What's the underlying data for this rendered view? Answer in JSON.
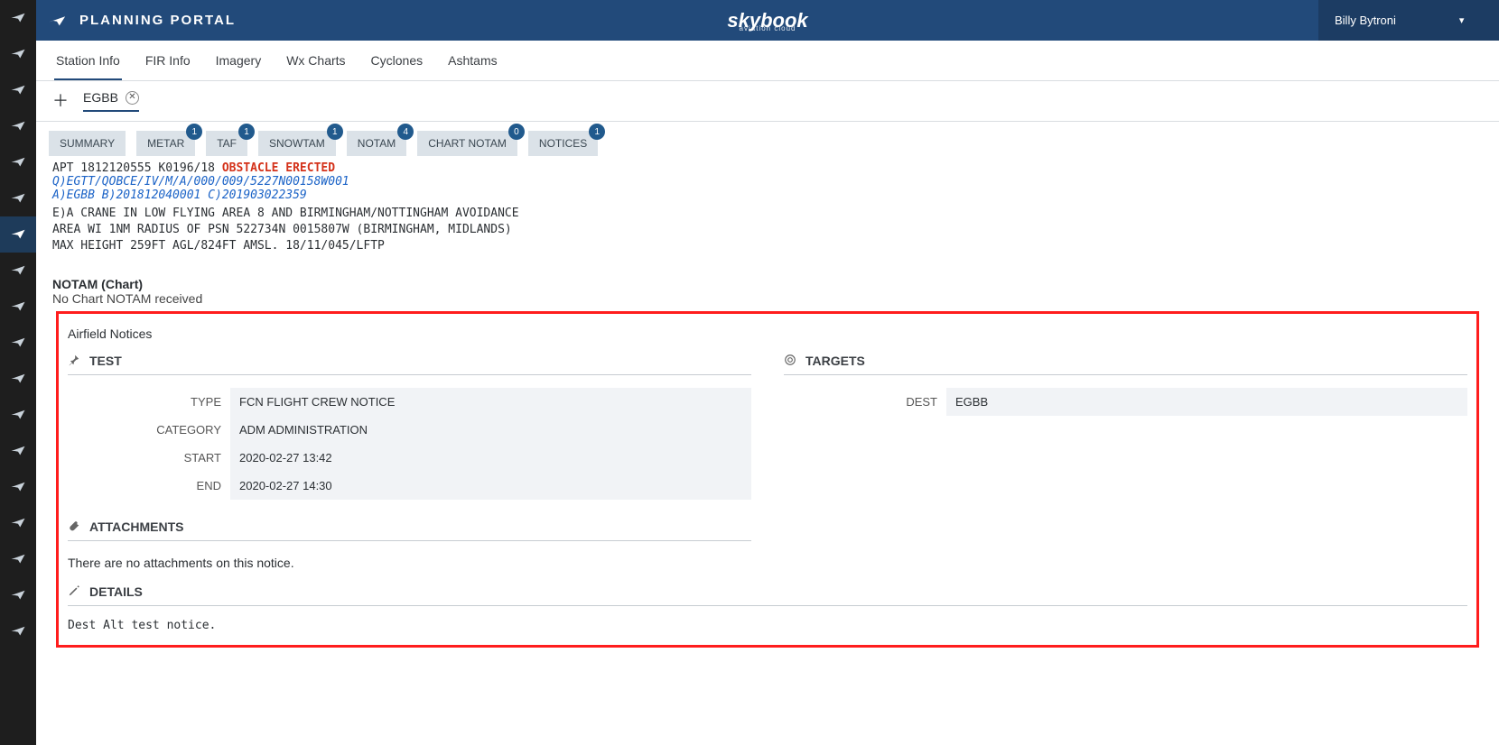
{
  "header": {
    "title": "PLANNING PORTAL",
    "brand": "skybook",
    "brand_sub": "aviation cloud",
    "user_name": "Billy Bytroni"
  },
  "sidebar": {
    "items": [
      {
        "name": "grid-icon"
      },
      {
        "name": "plane-icon"
      },
      {
        "name": "plane-double-icon"
      },
      {
        "name": "globe-icon"
      },
      {
        "name": "add-module-icon"
      },
      {
        "name": "list-icon"
      },
      {
        "name": "crossed-plane-icon",
        "active": true
      },
      {
        "name": "sun-icon"
      },
      {
        "name": "pin-icon"
      },
      {
        "name": "id-card-icon"
      },
      {
        "name": "clipboard-icon"
      },
      {
        "name": "bars-icon"
      },
      {
        "name": "map-icon"
      },
      {
        "name": "gears-icon"
      },
      {
        "name": "user-icon"
      },
      {
        "name": "html-icon"
      },
      {
        "name": "monitor-icon"
      },
      {
        "name": "warning-icon"
      }
    ]
  },
  "toptabs": {
    "items": [
      {
        "label": "Station Info",
        "active": true
      },
      {
        "label": "FIR Info"
      },
      {
        "label": "Imagery"
      },
      {
        "label": "Wx Charts"
      },
      {
        "label": "Cyclones"
      },
      {
        "label": "Ashtams"
      }
    ]
  },
  "station": {
    "code": "EGBB"
  },
  "subtabs": {
    "items": [
      {
        "label": "SUMMARY"
      },
      {
        "label": "METAR",
        "badge": "1"
      },
      {
        "label": "TAF",
        "badge": "1"
      },
      {
        "label": "SNOWTAM",
        "badge": "1"
      },
      {
        "label": "NOTAM",
        "badge": "4"
      },
      {
        "label": "CHART NOTAM",
        "badge": "0"
      },
      {
        "label": "NOTICES",
        "badge": "1"
      }
    ]
  },
  "notam": {
    "id": "APT 1812120555 K0196/18 ",
    "warning": "OBSTACLE ERECTED",
    "q_line": "Q)EGTT/QOBCE/IV/M/A/000/009/5227N00158W001",
    "a_line": "A)EGBB B)201812040001 C)201903022359",
    "e_body": "E)A CRANE IN LOW FLYING AREA 8 AND BIRMINGHAM/NOTTINGHAM AVOIDANCE\nAREA WI 1NM RADIUS OF PSN 522734N 0015807W (BIRMINGHAM, MIDLANDS)\nMAX HEIGHT 259FT AGL/824FT AMSL. 18/11/045/LFTP"
  },
  "notam_chart": {
    "title": "NOTAM (Chart)",
    "text": "No Chart NOTAM received"
  },
  "airfield_notices": {
    "title": "Airfield Notices",
    "test_title": "TEST",
    "targets_title": "TARGETS",
    "rows": [
      {
        "k": "TYPE",
        "v": "FCN FLIGHT CREW NOTICE"
      },
      {
        "k": "CATEGORY",
        "v": "ADM ADMINISTRATION"
      },
      {
        "k": "START",
        "v": "2020-02-27 13:42"
      },
      {
        "k": "END",
        "v": "2020-02-27 14:30"
      }
    ],
    "targets": [
      {
        "k": "DEST",
        "v": "EGBB"
      }
    ],
    "attachments_title": "ATTACHMENTS",
    "attachments_text": "There are no attachments on this notice.",
    "details_title": "DETAILS",
    "details_text": "Dest Alt test notice."
  }
}
